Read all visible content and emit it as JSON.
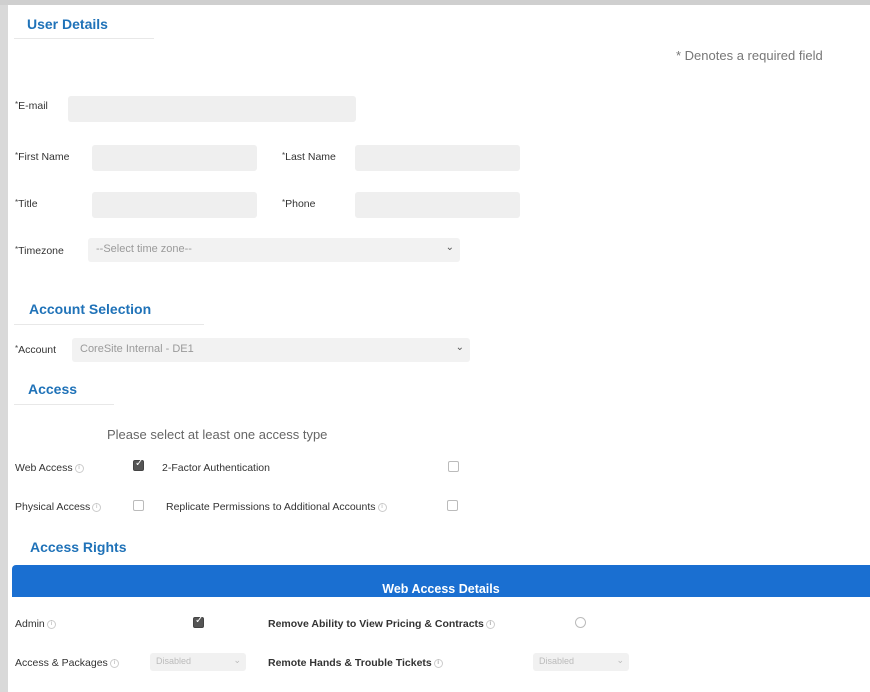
{
  "user_details": {
    "title": "User Details",
    "required_note": "* Denotes a required field",
    "email_label": "E-mail",
    "first_name_label": "First Name",
    "last_name_label": "Last Name",
    "title_label": "Title",
    "phone_label": "Phone",
    "timezone_label": "Timezone",
    "timezone_value": "--Select time zone--"
  },
  "account_selection": {
    "title": "Account Selection",
    "account_label": "Account",
    "account_value": "CoreSite Internal - DE1"
  },
  "access": {
    "title": "Access",
    "hint": "Please select at least one access type",
    "web_access_label": "Web Access",
    "web_access_checked": true,
    "two_factor_label": "2-Factor Authentication",
    "two_factor_checked": false,
    "physical_access_label": "Physical Access",
    "physical_access_checked": false,
    "replicate_label": "Replicate Permissions to Additional Accounts",
    "replicate_checked": false
  },
  "access_rights": {
    "title": "Access Rights",
    "bar_title": "Web Access Details",
    "admin_label": "Admin",
    "admin_checked": true,
    "remove_pricing_label": "Remove Ability to View Pricing & Contracts",
    "remove_pricing_checked": false,
    "access_packages_label": "Access & Packages",
    "access_packages_value": "Disabled",
    "remote_hands_label": "Remote Hands & Trouble Tickets",
    "remote_hands_value": "Disabled"
  },
  "icons": {
    "chevron": "chevron-down-icon",
    "info": "info-icon",
    "checkbox": "checkbox-icon"
  },
  "colors": {
    "accent": "#1f72b8",
    "bar": "#1a6fd1"
  }
}
